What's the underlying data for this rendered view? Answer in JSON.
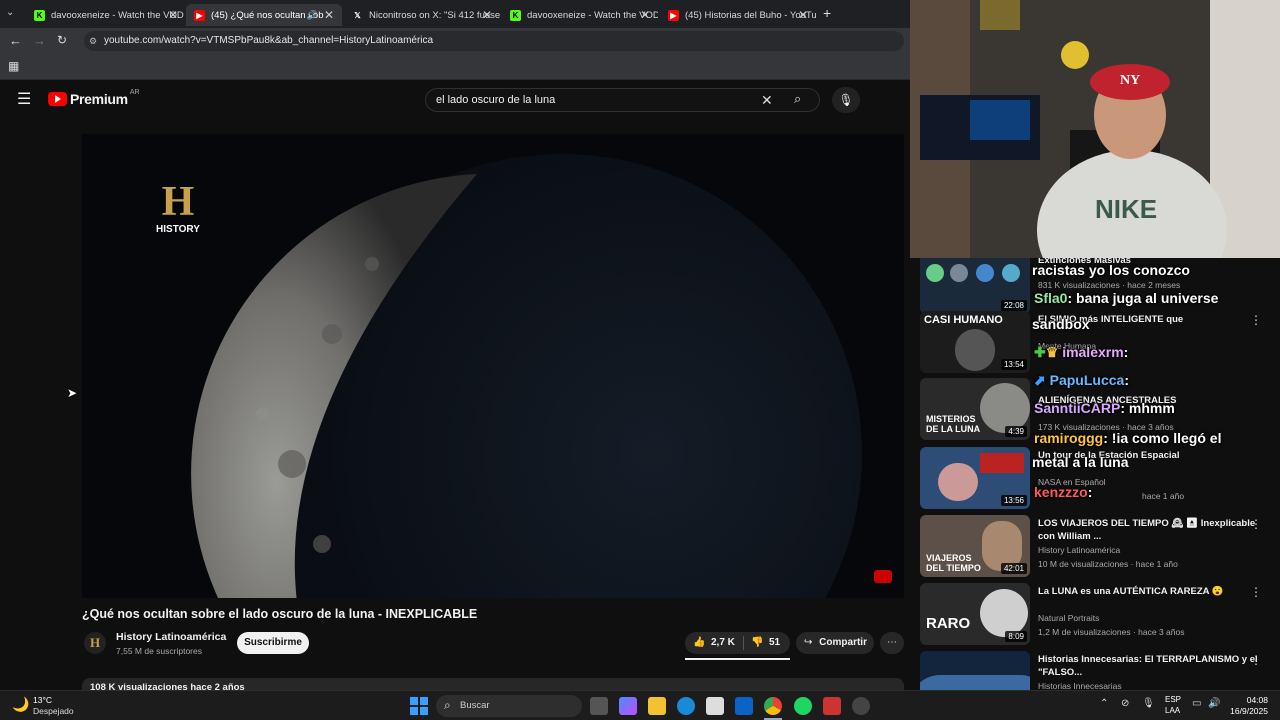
{
  "tabs": [
    {
      "label": "davooxeneize - Watch the VOD",
      "active": false
    },
    {
      "label": "(45) ¿Qué nos ocultan sob",
      "active": true
    },
    {
      "label": "Niconitroso on X: \"Si 412 fuese",
      "active": false
    },
    {
      "label": "davooxeneize - Watch the VOD",
      "active": false
    },
    {
      "label": "(45) Historias del Buho - YouTu",
      "active": false
    }
  ],
  "address": {
    "url": "youtube.com/watch?v=VTMSPbPau8k&ab_channel=HistoryLatinoamérica"
  },
  "youtube": {
    "logo": "Premium",
    "region": "AR",
    "search_value": "el lado oscuro de la luna",
    "history_logo": "HISTORY",
    "video_title": "¿Qué nos ocultan sobre el lado oscuro de la luna - INEXPLICABLE",
    "channel_name": "History Latinoamérica",
    "subscribers": "7,55 M de suscriptores",
    "subscribe_label": "Suscribirme",
    "likes": "2,7 K",
    "dislikes": "51",
    "share_label": "Compartir",
    "views_line": "108 K visualizaciones  hace 2 años"
  },
  "recommendations": [
    {
      "title": "Extinciones Masivas",
      "channel": "831 K visualizaciones · hace 2 meses",
      "duration": "22:08",
      "thumb_text": ""
    },
    {
      "title": "El SIMIO más INTELIGENTE que",
      "channel": "Mente Humana",
      "meta": "",
      "duration": "13:54",
      "thumb_text": "CASI HUMANO"
    },
    {
      "title": "ALIENÍGENAS ANCESTRALES",
      "channel": "173 K visualizaciones · hace 3 años",
      "duration": "4:39",
      "thumb_text": "MISTERIOS DE LA LUNA"
    },
    {
      "title": "Un tour de la Estación Espacial",
      "channel": "NASA en Español",
      "meta": "hace 1 año",
      "duration": "13:56",
      "thumb_text": ""
    },
    {
      "title": "LOS VIAJEROS DEL TIEMPO 🕰 ⏏ Inexplicable con William ...",
      "channel": "History Latinoamérica",
      "meta": "10 M de visualizaciones · hace 1 año",
      "duration": "42:01",
      "thumb_text": "VIAJEROS DEL TIEMPO"
    },
    {
      "title": "La LUNA es una AUTÉNTICA RAREZA 😮",
      "channel": "Natural Portraits",
      "meta": "1,2 M de visualizaciones · hace 3 años",
      "duration": "8:09",
      "thumb_text": "RARO"
    },
    {
      "title": "Historias Innecesarias: El TERRAPLANISMO y el \"FALSO...",
      "channel": "Historias Innecesarias",
      "meta": "",
      "duration": "",
      "thumb_text": ""
    }
  ],
  "chat": [
    {
      "user": "",
      "msg": "racistas yo los conozco"
    },
    {
      "user": "Sfla0",
      "msg": ": bana juga al universe"
    },
    {
      "user": "",
      "msg": "sandbox"
    },
    {
      "user": "imalexrm",
      "msg": ":"
    },
    {
      "user": "PapuLucca",
      "msg": ":"
    },
    {
      "user": "SanntiiCARP",
      "msg": ": mhmm"
    },
    {
      "user": "ramiroggg",
      "msg": ": !ia como llegó el"
    },
    {
      "user": "",
      "msg": "metal a la luna"
    },
    {
      "user": "kenzzzo",
      "msg": ":"
    }
  ],
  "taskbar": {
    "weather_temp": "13°C",
    "weather_desc": "Despejado",
    "search_label": "Buscar",
    "lang1": "ESP",
    "lang2": "LAA",
    "time": "04:08",
    "date": "16/9/2025"
  },
  "colors": {
    "yt_red": "#ff0000",
    "chrome_bg": "#1f2023",
    "page_bg": "#0f0f0f"
  }
}
